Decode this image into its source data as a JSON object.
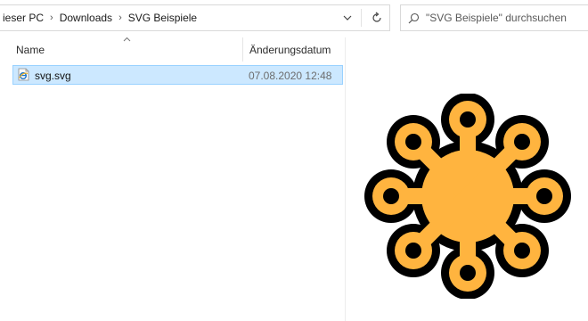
{
  "breadcrumb": {
    "items": [
      "ieser PC",
      "Downloads",
      "SVG Beispiele"
    ]
  },
  "search": {
    "placeholder": "\"SVG Beispiele\" durchsuchen"
  },
  "columns": {
    "name": "Name",
    "date": "Änderungsdatum"
  },
  "files": [
    {
      "name": "svg.svg",
      "modified": "07.08.2020 12:48",
      "selected": true
    }
  ],
  "colors": {
    "selection": "#cce8ff",
    "preview_fill": "#ffb43f",
    "preview_outline": "#000000"
  }
}
